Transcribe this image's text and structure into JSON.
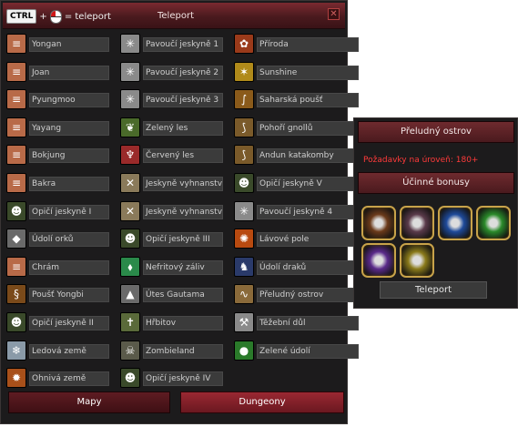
{
  "window": {
    "title": "Teleport",
    "hint": {
      "key": "CTRL",
      "plus": "+",
      "text": "= teleport"
    },
    "close": "✕"
  },
  "columns": [
    [
      {
        "label": "Yongan",
        "icon": "scroll-icon"
      },
      {
        "label": "Joan",
        "icon": "scroll-icon"
      },
      {
        "label": "Pyungmoo",
        "icon": "scroll-icon"
      },
      {
        "label": "Yayang",
        "icon": "scroll-icon"
      },
      {
        "label": "Bokjung",
        "icon": "scroll-icon"
      },
      {
        "label": "Bakra",
        "icon": "scroll-icon"
      },
      {
        "label": "Opičí jeskyně I",
        "icon": "monkey-icon"
      },
      {
        "label": "Údolí orků",
        "icon": "rock-icon"
      },
      {
        "label": "Chrám",
        "icon": "scroll-icon"
      },
      {
        "label": "Poušť Yongbi",
        "icon": "serpent-icon"
      },
      {
        "label": "Opičí jeskyně II",
        "icon": "monkey-icon"
      },
      {
        "label": "Ledová země",
        "icon": "ice-icon"
      },
      {
        "label": "Ohnivá země",
        "icon": "fire-icon"
      }
    ],
    [
      {
        "label": "Pavoučí jeskyně 1",
        "icon": "spider-icon"
      },
      {
        "label": "Pavoučí jeskyně 2",
        "icon": "spider-icon"
      },
      {
        "label": "Pavoučí jeskyně 3",
        "icon": "spider-icon"
      },
      {
        "label": "Zelený les",
        "icon": "leaf-icon"
      },
      {
        "label": "Červený les",
        "icon": "coral-icon"
      },
      {
        "label": "Jeskyně vyhnanství I",
        "icon": "bones-icon"
      },
      {
        "label": "Jeskyně vyhnanství II",
        "icon": "bones-icon"
      },
      {
        "label": "Opičí jeskyně III",
        "icon": "monkey-icon"
      },
      {
        "label": "Nefritový záliv",
        "icon": "jade-icon"
      },
      {
        "label": "Útes Gautama",
        "icon": "cliff-icon"
      },
      {
        "label": "Hřbitov",
        "icon": "grave-icon"
      },
      {
        "label": "Zombieland",
        "icon": "zombie-icon"
      },
      {
        "label": "Opičí jeskyně IV",
        "icon": "monkey-icon"
      }
    ],
    [
      {
        "label": "Příroda",
        "icon": "flower-icon"
      },
      {
        "label": "Sunshine",
        "icon": "sun-icon"
      },
      {
        "label": "Saharská poušť",
        "icon": "scorpion-icon"
      },
      {
        "label": "Pohoří gnollů",
        "icon": "claw-icon"
      },
      {
        "label": "Andun katakomby",
        "icon": "claw-icon"
      },
      {
        "label": "Opičí jeskyně V",
        "icon": "monkey-icon"
      },
      {
        "label": "Pavoučí jeskyně 4",
        "icon": "spider-icon"
      },
      {
        "label": "Lávové pole",
        "icon": "lava-icon"
      },
      {
        "label": "Údolí draků",
        "icon": "dragon-icon"
      },
      {
        "label": "Přeludný ostrov",
        "icon": "lizard-icon"
      },
      {
        "label": "Těžební důl",
        "icon": "mine-icon"
      },
      {
        "label": "Zelené údolí",
        "icon": "beetle-icon"
      }
    ]
  ],
  "buttons": {
    "maps": "Mapy",
    "dungeons": "Dungeony"
  },
  "side": {
    "title": "Přeludný ostrov",
    "requirement": "Požadavky na úroveň: 180+",
    "bonus_title": "Účinné bonusy",
    "bonuses": [
      {
        "name": "paw-bonus-icon",
        "color": "#6b3a1a"
      },
      {
        "name": "skull-bonus-icon",
        "color": "#5a3a4a"
      },
      {
        "name": "blue-rune-bonus-icon",
        "color": "#1e4a9a"
      },
      {
        "name": "green-orb-bonus-icon",
        "color": "#2a8a2a"
      },
      {
        "name": "purple-rune-bonus-icon",
        "color": "#5a2a8a"
      },
      {
        "name": "gold-orb-bonus-icon",
        "color": "#8a7a1a"
      }
    ],
    "teleport": "Teleport"
  },
  "icon_styles": {
    "scroll-icon": {
      "bg": "#b86a48",
      "glyph": "≡"
    },
    "monkey-icon": {
      "bg": "#3a4a2a",
      "glyph": "☻"
    },
    "rock-icon": {
      "bg": "#6a6a6a",
      "glyph": "◆"
    },
    "serpent-icon": {
      "bg": "#7a4a1a",
      "glyph": "§"
    },
    "ice-icon": {
      "bg": "#8a9aa8",
      "glyph": "❄"
    },
    "fire-icon": {
      "bg": "#a8501a",
      "glyph": "✹"
    },
    "spider-icon": {
      "bg": "#8a8a8a",
      "glyph": "✳"
    },
    "leaf-icon": {
      "bg": "#4a6a2a",
      "glyph": "❦"
    },
    "coral-icon": {
      "bg": "#9a2a2a",
      "glyph": "♆"
    },
    "bones-icon": {
      "bg": "#8a7a5a",
      "glyph": "✕"
    },
    "jade-icon": {
      "bg": "#2a8a4a",
      "glyph": "⬧"
    },
    "cliff-icon": {
      "bg": "#6a6a6a",
      "glyph": "▲"
    },
    "grave-icon": {
      "bg": "#5a6a3a",
      "glyph": "✝"
    },
    "zombie-icon": {
      "bg": "#5a5a4a",
      "glyph": "☠"
    },
    "flower-icon": {
      "bg": "#9a3a1a",
      "glyph": "✿"
    },
    "sun-icon": {
      "bg": "#b08a1a",
      "glyph": "✶"
    },
    "scorpion-icon": {
      "bg": "#8a5a1a",
      "glyph": "∫"
    },
    "claw-icon": {
      "bg": "#7a5a2a",
      "glyph": "⟆"
    },
    "lava-icon": {
      "bg": "#b84a10",
      "glyph": "✺"
    },
    "dragon-icon": {
      "bg": "#2a3a6a",
      "glyph": "♞"
    },
    "lizard-icon": {
      "bg": "#8a6a3a",
      "glyph": "∿"
    },
    "mine-icon": {
      "bg": "#8a8a8a",
      "glyph": "⚒"
    },
    "beetle-icon": {
      "bg": "#2a7a2a",
      "glyph": "●"
    }
  }
}
